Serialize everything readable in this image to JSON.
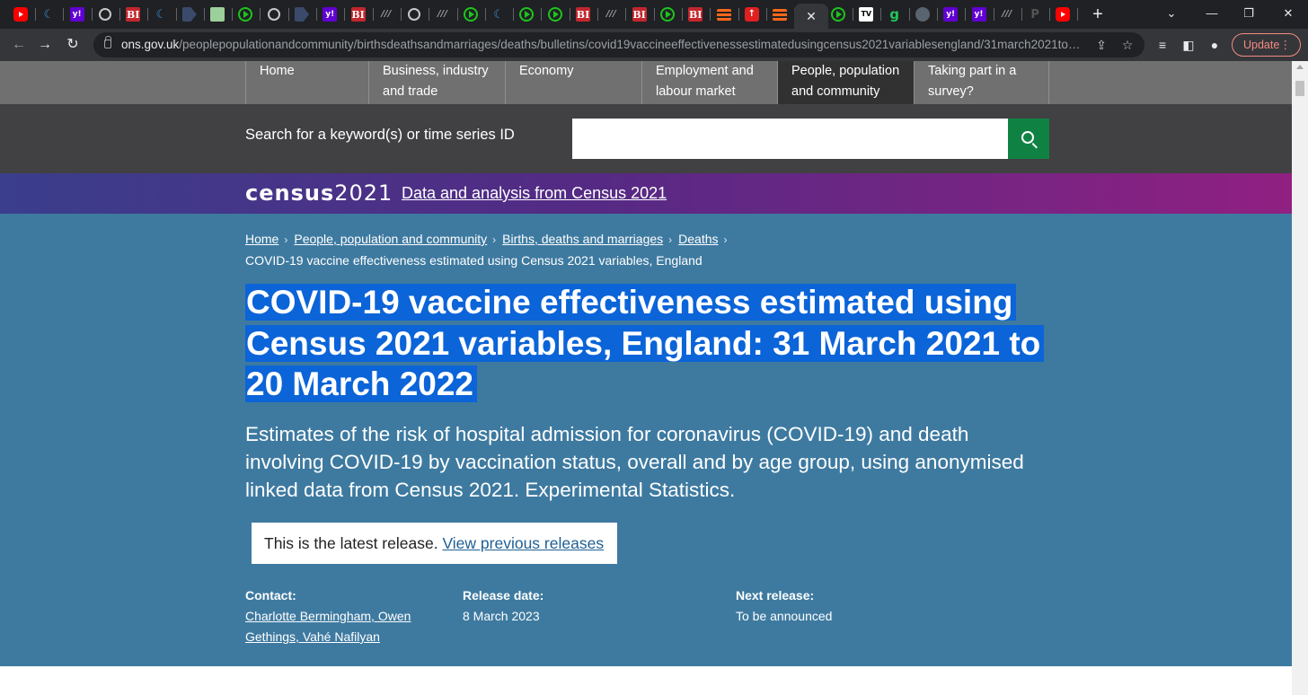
{
  "browser": {
    "tabs": [
      {
        "icon": "youtube-icon"
      },
      {
        "icon": "shield-icon"
      },
      {
        "icon": "yahoo-icon"
      },
      {
        "icon": "globe-icon"
      },
      {
        "icon": "business-insider-icon"
      },
      {
        "icon": "shield-icon"
      },
      {
        "icon": "arrow-icon"
      },
      {
        "icon": "square-icon"
      },
      {
        "icon": "play-icon"
      },
      {
        "icon": "globe-icon"
      },
      {
        "icon": "arrow-icon"
      },
      {
        "icon": "yahoo-icon"
      },
      {
        "icon": "business-insider-icon"
      },
      {
        "icon": "italic-lines-icon"
      },
      {
        "icon": "globe-icon"
      },
      {
        "icon": "italic-lines-icon"
      },
      {
        "icon": "play-icon"
      },
      {
        "icon": "shield-icon"
      },
      {
        "icon": "play-icon"
      },
      {
        "icon": "play-icon"
      },
      {
        "icon": "business-insider-icon"
      },
      {
        "icon": "italic-lines-icon"
      },
      {
        "icon": "business-insider-icon"
      },
      {
        "icon": "play-icon"
      },
      {
        "icon": "business-insider-icon"
      },
      {
        "icon": "substack-icon"
      },
      {
        "icon": "red-arrow-icon"
      },
      {
        "icon": "substack-icon"
      }
    ],
    "tabs_after_active": [
      {
        "icon": "play-icon"
      },
      {
        "icon": "tv-icon"
      },
      {
        "icon": "g-icon"
      },
      {
        "icon": "person-icon"
      },
      {
        "icon": "yahoo-icon"
      },
      {
        "icon": "yahoo-icon"
      },
      {
        "icon": "italic-lines-icon"
      },
      {
        "icon": "p-icon"
      },
      {
        "icon": "youtube-icon"
      }
    ],
    "active_tab_close": "✕",
    "new_tab": "+",
    "url_host": "ons.gov.uk",
    "url_path": "/peoplepopulationandcommunity/birthsdeathsandmarriages/deaths/bulletins/covid19vaccineeffectivenessestimatedusingcensus2021variablesengland/31march2021to20...",
    "update_label": "Update",
    "update_menu": "⋮",
    "colors": {
      "tabstrip": "#202124",
      "toolbar": "#35363a",
      "update_accent": "#f28b82"
    }
  },
  "nav": {
    "items": [
      {
        "label": "Home"
      },
      {
        "label": "Business, industry and trade"
      },
      {
        "label": "Economy"
      },
      {
        "label": "Employment and labour market"
      },
      {
        "label": "People, population and community"
      },
      {
        "label": "Taking part in a survey?"
      }
    ],
    "active_index": 4
  },
  "search": {
    "label": "Search for a keyword(s) or time series ID",
    "value": "",
    "button_icon": "search-icon"
  },
  "census": {
    "logo_word": "census",
    "logo_year": "2021",
    "link": "Data and analysis from Census 2021"
  },
  "breadcrumb": {
    "items": [
      {
        "label": "Home"
      },
      {
        "label": "People, population and community"
      },
      {
        "label": "Births, deaths and marriages"
      },
      {
        "label": "Deaths"
      }
    ],
    "current": "COVID-19 vaccine effectiveness estimated using Census 2021 variables, England"
  },
  "page": {
    "title": "COVID-19 vaccine effectiveness estimated using Census 2021 variables, England: 31 March 2021 to 20 March 2022",
    "summary": "Estimates of the risk of hospital admission for coronavirus (COVID-19) and death involving COVID-19 by vaccination status, overall and by age group, using anonymised linked data from Census 2021. Experimental Statistics.",
    "latest_text": "This is the latest release.",
    "latest_link": "View previous releases",
    "contact_label": "Contact:",
    "contact_value": "Charlotte Bermingham, Owen Gethings, Vahé Nafilyan",
    "release_label": "Release date:",
    "release_value": "8 March 2023",
    "next_label": "Next release:",
    "next_value": "To be announced"
  },
  "colors": {
    "nav_bg": "#707071",
    "nav_active": "#323132",
    "search_band": "#414042",
    "search_button": "#0f8243",
    "hero": "#3e7aa0",
    "title_highlight": "#0b64d8",
    "link": "#206095"
  }
}
